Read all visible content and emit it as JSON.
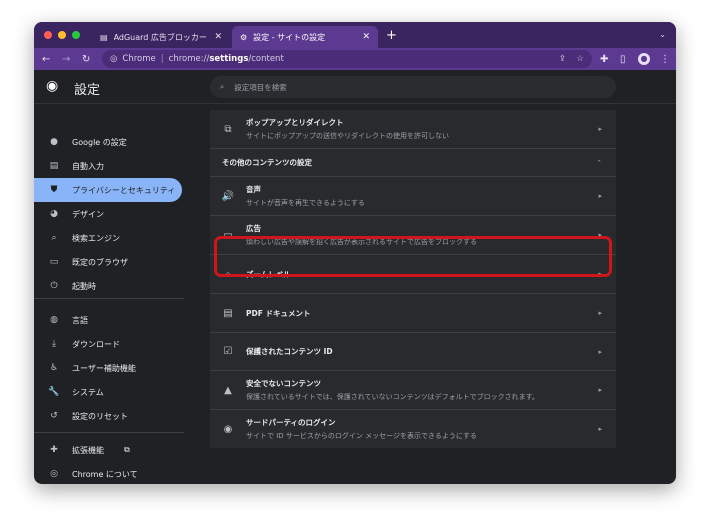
{
  "tabs": [
    {
      "label": "AdGuard 広告ブロッカー - Chrom",
      "icon": "adguard-icon"
    },
    {
      "label": "設定 - サイトの設定",
      "icon": "gear-icon",
      "active": true
    }
  ],
  "toolbar": {
    "site_label": "Chrome",
    "url_prefix": "chrome://",
    "url_bold": "settings",
    "url_suffix": "/content"
  },
  "header": {
    "title": "設定",
    "search_placeholder": "設定項目を検索"
  },
  "sidebar": {
    "items": [
      {
        "label": "Google の設定",
        "icon": "person-icon"
      },
      {
        "label": "自動入力",
        "icon": "clipboard-icon"
      },
      {
        "label": "プライバシーとセキュリティ",
        "icon": "shield-icon",
        "active": true
      },
      {
        "label": "デザイン",
        "icon": "palette-icon"
      },
      {
        "label": "検索エンジン",
        "icon": "search-icon"
      },
      {
        "label": "既定のブラウザ",
        "icon": "browser-icon"
      },
      {
        "label": "起動時",
        "icon": "power-icon"
      },
      {
        "label": "言語",
        "icon": "globe-icon"
      },
      {
        "label": "ダウンロード",
        "icon": "download-icon"
      },
      {
        "label": "ユーザー補助機能",
        "icon": "accessibility-icon"
      },
      {
        "label": "システム",
        "icon": "wrench-icon"
      },
      {
        "label": "設定のリセット",
        "icon": "reset-icon"
      },
      {
        "label": "拡張機能",
        "icon": "puzzle-icon"
      },
      {
        "label": "Chrome について",
        "icon": "chrome-icon"
      }
    ]
  },
  "content": {
    "popup": {
      "title": "ポップアップとリダイレクト",
      "desc": "サイトにポップアップの送信やリダイレクトの使用を許可しない"
    },
    "section_title": "その他のコンテンツの設定",
    "rows": [
      {
        "title": "音声",
        "desc": "サイトが音声を再生できるようにする",
        "icon": "speaker-icon"
      },
      {
        "title": "広告",
        "desc": "煩わしい広告や誤解を招く広告が表示されるサイトで広告をブロックする",
        "icon": "window-icon",
        "highlighted": true
      },
      {
        "title": "ズームレベル",
        "desc": "",
        "icon": "zoom-icon"
      },
      {
        "title": "PDF ドキュメント",
        "desc": "",
        "icon": "pdf-icon"
      },
      {
        "title": "保護されたコンテンツ ID",
        "desc": "",
        "icon": "protected-content-icon"
      },
      {
        "title": "安全でないコンテンツ",
        "desc": "保護されているサイトでは、保護されていないコンテンツはデフォルトでブロックされます。",
        "icon": "warning-icon"
      },
      {
        "title": "サードパーティのログイン",
        "desc": "サイトで ID サービスからのログイン メッセージを表示できるようにする",
        "icon": "account-icon"
      }
    ]
  },
  "colors": {
    "highlight": "#d0161a",
    "accent": "#8ab4f8",
    "frame": "#5d3a91"
  }
}
